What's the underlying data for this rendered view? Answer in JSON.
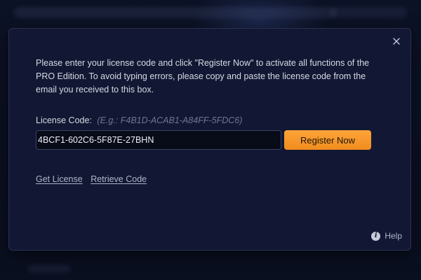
{
  "dialog": {
    "description": "Please enter your license code and click \"Register Now\" to activate all functions of the PRO Edition. To avoid typing errors, please copy and paste the license code from the email you received to this box.",
    "license_label": "License Code:",
    "license_hint": "(E.g.: F4B1D-ACAB1-A84FF-5FDC6)",
    "license_value": "4BCF1-602C6-5F87E-27BHN",
    "register_label": "Register Now",
    "get_license_label": "Get License",
    "retrieve_code_label": "Retrieve Code",
    "help_label": "Help",
    "close_icon": "close-icon",
    "help_icon": "info-icon"
  },
  "colors": {
    "dialog_bg": "#121833",
    "accent": "#f5961f",
    "text": "#d6d9e4",
    "hint": "#6f7692"
  }
}
